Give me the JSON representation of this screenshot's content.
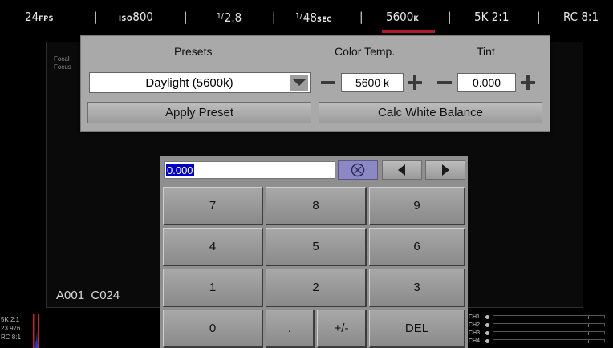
{
  "status_bar": {
    "fps_value": "24",
    "fps_unit": "FPS",
    "iso_prefix": "ISO",
    "iso_value": "800",
    "aperture_prefix": "1/",
    "aperture_value": "2.8",
    "shutter_prefix": "1/",
    "shutter_value": "48",
    "shutter_unit": "SEC",
    "kelvin_value": "5600",
    "kelvin_unit": "K",
    "resolution": "5K 2:1",
    "compression": "RC 8:1",
    "separator": "|"
  },
  "viewport": {
    "focal_label": "Focal",
    "focus_label": "Focus",
    "clip_name": "A001_C024"
  },
  "white_balance": {
    "presets_heading": "Presets",
    "color_temp_heading": "Color Temp.",
    "tint_heading": "Tint",
    "preset_selected": "Daylight (5600k)",
    "color_temp_value": "5600 k",
    "tint_value": "0.000",
    "apply_preset_label": "Apply Preset",
    "calc_wb_label": "Calc White Balance"
  },
  "keypad": {
    "input_value": "0.000",
    "clear_icon": "circle-x-icon",
    "keys": [
      {
        "label": "7"
      },
      {
        "label": "8"
      },
      {
        "label": "9"
      },
      {
        "label": "4"
      },
      {
        "label": "5"
      },
      {
        "label": "6"
      },
      {
        "label": "1"
      },
      {
        "label": "2"
      },
      {
        "label": "3"
      },
      {
        "label": "0"
      },
      {
        "label": "."
      },
      {
        "label": "+/-"
      },
      {
        "label": "DEL"
      }
    ]
  },
  "bottom_left": {
    "resolution": "5K 2:1",
    "framerate": "23.976",
    "compression": "RC 8:1"
  },
  "audio": {
    "channels": [
      "CH1",
      "CH2",
      "CH3",
      "CH4"
    ]
  },
  "colors": {
    "accent_red": "#b0192a",
    "panel_gray": "#a9a9a9",
    "keypad_gray": "#8f8f8f",
    "selection_blue": "#0000c8"
  }
}
